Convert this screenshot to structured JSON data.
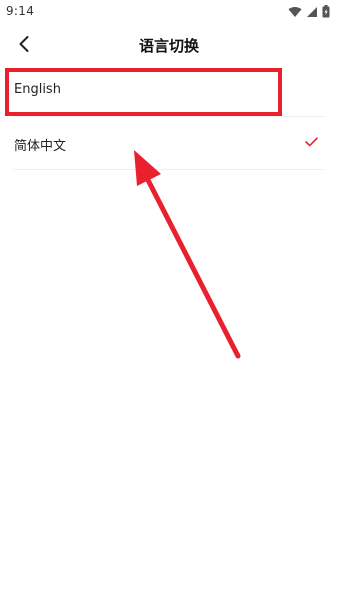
{
  "status_bar": {
    "time": "9:14",
    "icons": [
      "wifi-icon",
      "signal-icon",
      "battery-icon"
    ]
  },
  "header": {
    "back_icon": "chevron-left-icon",
    "title": "语言切换"
  },
  "languages": [
    {
      "label": "English",
      "selected": false
    },
    {
      "label": "简体中文",
      "selected": true
    }
  ],
  "colors": {
    "accent": "#e8202f",
    "annotation": "#e8202f",
    "divider": "#efefef"
  }
}
